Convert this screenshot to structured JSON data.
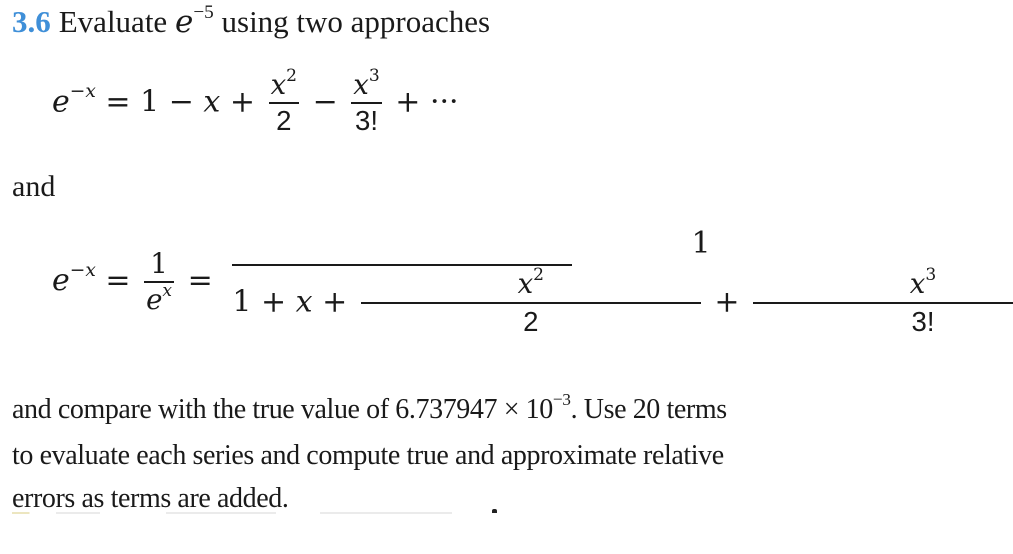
{
  "problem": {
    "number": "3.6",
    "title_text": "Evaluate",
    "title_base": "e",
    "title_exponent": "−5",
    "title_rest": "using two approaches",
    "accent_color": "#3f8fd8"
  },
  "equation1": {
    "lhs_base": "e",
    "lhs_exp": "−x",
    "equals": "=",
    "terms": {
      "t1": "1",
      "op1": "−",
      "t2": "x",
      "op2": "+",
      "f1_num_base": "x",
      "f1_num_exp": "2",
      "f1_den": "2",
      "op3": "−",
      "f2_num_base": "x",
      "f2_num_exp": "3",
      "f2_den": "3!",
      "op4": "+",
      "ellipsis": "···"
    }
  },
  "connector": "and",
  "equation2": {
    "lhs_base": "e",
    "lhs_exp": "−x",
    "equals1": "=",
    "mid_num": "1",
    "mid_den_base": "e",
    "mid_den_exp": "x",
    "equals2": "=",
    "big_num": "1",
    "den": {
      "t1": "1",
      "op1": "+",
      "t2": "x",
      "op2": "+",
      "f1_num_base": "x",
      "f1_num_exp": "2",
      "f1_den": "2",
      "op3": "+",
      "f2_num_base": "x",
      "f2_num_exp": "3",
      "f2_den": "3!",
      "op4": "+",
      "ellipsis": "···"
    }
  },
  "paragraph": {
    "line1_a": "and compare with the true value of 6.737947 × 10",
    "line1_exp": "−3",
    "line1_b": ". Use 20 terms",
    "line2": "to evaluate each series and compute true and approximate relative",
    "line3": "errors as terms are added."
  }
}
